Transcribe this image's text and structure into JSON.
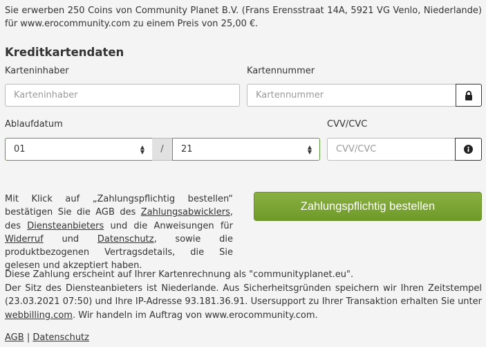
{
  "intro_text": "Sie erwerben 250 Coins von Community Planet B.V. (Frans Erensstraat 14A, 5921 VG Venlo, Niederlande) für www.erocommunity.com zu einem Preis von 25,00 €.",
  "section_title": "Kreditkartendaten",
  "cardholder": {
    "label": "Karteninhaber",
    "placeholder": "Karteninhaber"
  },
  "cardnumber": {
    "label": "Kartennummer",
    "placeholder": "Kartennummer"
  },
  "expiry": {
    "label": "Ablaufdatum",
    "month": "01",
    "separator": "/",
    "year": "21"
  },
  "cvv": {
    "label": "CVV/CVC",
    "placeholder": "CVV/CVC"
  },
  "consent": {
    "part1": "Mit Klick auf „Zahlungspflichtig bestellen“ bestätigen Sie die AGB des ",
    "link1": "Zahlungsabwicklers",
    "part2": ", des ",
    "link2": "Diensteanbieters",
    "part3": " und die Anweisungen für ",
    "link3": "Widerruf",
    "part4": " und ",
    "link4": "Datenschutz",
    "part5": ", sowie die produktbezogenen Vertragsdetails, die Sie gelesen und akzeptiert haben."
  },
  "pay_button": "Zahlungspflichtig bestellen",
  "footer": {
    "line1": "Diese Zahlung erscheint auf Ihrer Kartenrechnung als \"communityplanet.eu\".",
    "line2": "Der Sitz des Diensteanbieters ist Niederlande. Aus Sicherheitsgründen speichern wir Ihren Zeitstempel (23.03.2021 07:50) und Ihre IP-Adresse 93.181.36.91. Usersupport zu Ihrer Transaktion erhalten Sie unter ",
    "link": "webbilling.com",
    "line3": ". Wir handeln im Auftrag von www.erocommunity.com."
  },
  "bottom_links": {
    "agb": "AGB",
    "separator": "|",
    "datenschutz": "Datenschutz"
  },
  "icons": {
    "lock": "lock-icon",
    "info": "info-icon"
  },
  "colors": {
    "accent": "#7aa635",
    "valid_border": "#5a9a3a"
  }
}
